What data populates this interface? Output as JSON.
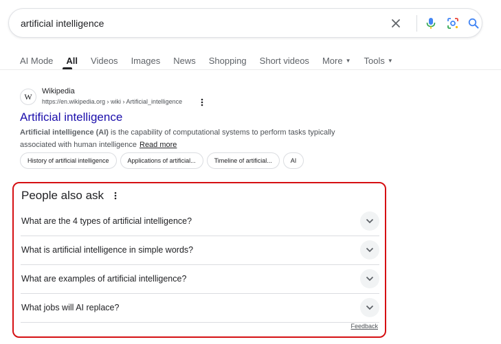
{
  "search": {
    "value": "artificial intelligence",
    "icons": {
      "clear": "close-icon",
      "mic": "mic-icon",
      "lens": "lens-icon",
      "search": "search-icon"
    }
  },
  "tabs": [
    {
      "label": "AI Mode"
    },
    {
      "label": "All",
      "active": true
    },
    {
      "label": "Videos"
    },
    {
      "label": "Images"
    },
    {
      "label": "News"
    },
    {
      "label": "Shopping"
    },
    {
      "label": "Short videos"
    },
    {
      "label": "More",
      "dropdown": true
    },
    {
      "label": "Tools",
      "dropdown": true
    }
  ],
  "result": {
    "favicon_letter": "W",
    "site_name": "Wikipedia",
    "url": "https://en.wikipedia.org › wiki › Artificial_intelligence",
    "title": "Artificial intelligence",
    "snippet_bold": "Artificial intelligence (AI)",
    "snippet_text": " is the capability of computational systems to perform tasks typically associated with human intelligence",
    "read_more": "Read more",
    "chips": [
      "History of artificial intelligence",
      "Applications of artificial...",
      "Timeline of artificial...",
      "AI"
    ]
  },
  "paa": {
    "title": "People also ask",
    "questions": [
      "What are the 4 types of artificial intelligence?",
      "What is artificial intelligence in simple words?",
      "What are examples of artificial intelligence?",
      "What jobs will AI replace?"
    ],
    "feedback": "Feedback"
  },
  "colors": {
    "link": "#1a0dab",
    "highlight_border": "#d50f12",
    "text": "#202124",
    "muted": "#5f6368"
  }
}
